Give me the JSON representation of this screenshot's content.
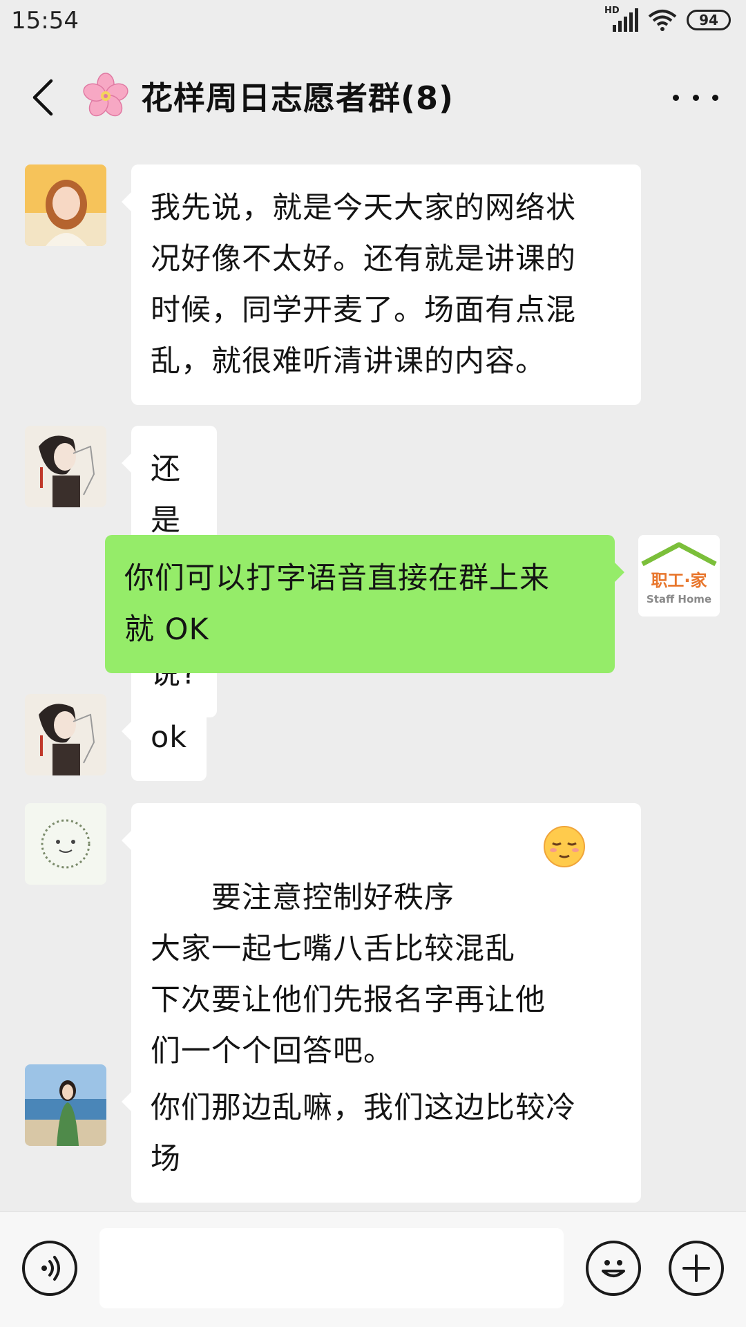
{
  "status_bar": {
    "time": "15:54",
    "network": "HD",
    "battery": "94"
  },
  "header": {
    "title": "花样周日志愿者群(8)",
    "icons": [
      "back-arrow-icon",
      "cherry-blossom-icon",
      "more-icon"
    ]
  },
  "messages": [
    {
      "side": "left",
      "avatar": "avatar-girl-yellow",
      "text": "我先说，就是今天大家的网络状\n况好像不太好。还有就是讲课的\n时候，同学开麦了。场面有点混\n乱，就很难听清讲课的内容。"
    },
    {
      "side": "left",
      "avatar": "avatar-drawn-girl",
      "text": "还是群里说?"
    },
    {
      "side": "right",
      "avatar": "avatar-staff-home-logo",
      "text": "你们可以打字语音直接在群上来\n就 OK"
    },
    {
      "side": "left",
      "avatar": "avatar-drawn-girl",
      "text": "ok"
    },
    {
      "side": "left",
      "avatar": "avatar-sun-sketch",
      "text": "要注意控制好秩序\n大家一起七嘴八舌比较混乱\n下次要让他们先报名字再让他\n们一个个回答吧。",
      "emoji": "relieved-face-emoji"
    },
    {
      "side": "left",
      "avatar": "avatar-beach-girl",
      "text": "你们那边乱嘛，我们这边比较冷\n场"
    }
  ],
  "logo": {
    "cn_text": "职工·家",
    "en_text": "Staff Home"
  },
  "input_bar": {
    "placeholder": "",
    "icons": [
      "voice-icon",
      "emoji-icon",
      "plus-icon"
    ]
  },
  "colors": {
    "background": "#ededed",
    "bubble_self": "#95ec69",
    "bubble_other": "#ffffff",
    "logo_green": "#7bbf3a",
    "logo_orange": "#e8762c"
  }
}
